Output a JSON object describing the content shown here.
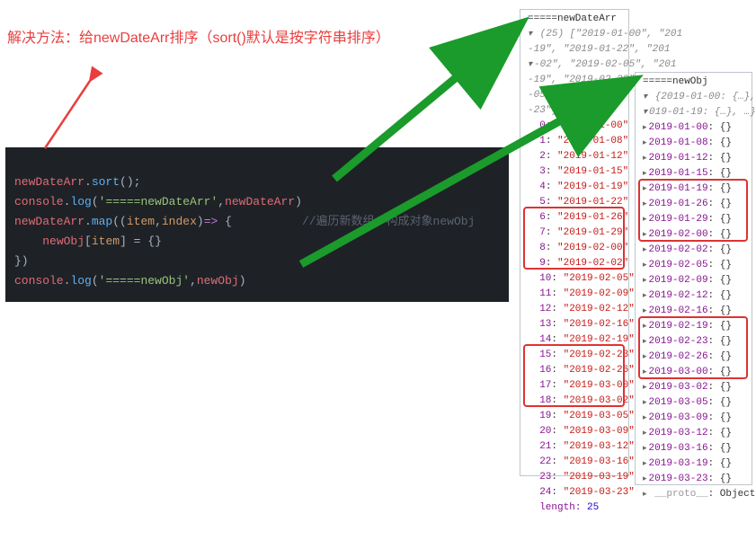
{
  "annotation": {
    "title": "解决方法：给newDateArr排序（sort()默认是按字符串排序）"
  },
  "code": {
    "l1_var": "newDateArr",
    "l1_fn": "sort",
    "l2_obj": "console",
    "l2_fn": "log",
    "l2_str": "'=====newDateArr'",
    "l2_arg": "newDateArr",
    "l3_var": "newDateArr",
    "l3_fn": "map",
    "l3_p1": "item",
    "l3_p2": "index",
    "l3_comment": "//遍历新数组，构成对象newObj",
    "l4_obj": "newObj",
    "l4_key": "item",
    "l6_obj": "console",
    "l6_fn": "log",
    "l6_str": "'=====newObj'",
    "l6_arg": "newObj"
  },
  "arr": {
    "label": "=====newDateArr",
    "summary1": "(25) [\"2019-01-00\", \"201",
    "summary2": "-19\", \"2019-01-22\", \"201",
    "summary3": "-02\", \"2019-02-05\", \"201",
    "summary4": "-19\", \"2019-02-23\", \"201",
    "summary5": "-05\", \"2019-03-",
    "summary6": "-23\"]",
    "items": [
      {
        "i": "0",
        "v": "2019-01-00"
      },
      {
        "i": "1",
        "v": "2019-01-08"
      },
      {
        "i": "2",
        "v": "2019-01-12"
      },
      {
        "i": "3",
        "v": "2019-01-15"
      },
      {
        "i": "4",
        "v": "2019-01-19"
      },
      {
        "i": "5",
        "v": "2019-01-22"
      },
      {
        "i": "6",
        "v": "2019-01-26"
      },
      {
        "i": "7",
        "v": "2019-01-29"
      },
      {
        "i": "8",
        "v": "2019-02-00"
      },
      {
        "i": "9",
        "v": "2019-02-02"
      },
      {
        "i": "10",
        "v": "2019-02-05"
      },
      {
        "i": "11",
        "v": "2019-02-09"
      },
      {
        "i": "12",
        "v": "2019-02-12"
      },
      {
        "i": "13",
        "v": "2019-02-16"
      },
      {
        "i": "14",
        "v": "2019-02-19"
      },
      {
        "i": "15",
        "v": "2019-02-23"
      },
      {
        "i": "16",
        "v": "2019-02-26"
      },
      {
        "i": "17",
        "v": "2019-03-00"
      },
      {
        "i": "18",
        "v": "2019-03-02"
      },
      {
        "i": "19",
        "v": "2019-03-05"
      },
      {
        "i": "20",
        "v": "2019-03-09"
      },
      {
        "i": "21",
        "v": "2019-03-12"
      },
      {
        "i": "22",
        "v": "2019-03-16"
      },
      {
        "i": "23",
        "v": "2019-03-19"
      },
      {
        "i": "24",
        "v": "2019-03-23"
      }
    ],
    "length_label": "length",
    "length_value": "25"
  },
  "obj": {
    "label": "=====newObj",
    "summary1": "{2019-01-00: {…}, 201",
    "summary2": "019-01-19: {…}, …}",
    "items": [
      "2019-01-00",
      "2019-01-08",
      "2019-01-12",
      "2019-01-15",
      "2019-01-19",
      "2019-01-26",
      "2019-01-29",
      "2019-02-00",
      "2019-02-02",
      "2019-02-05",
      "2019-02-09",
      "2019-02-12",
      "2019-02-16",
      "2019-02-19",
      "2019-02-23",
      "2019-02-26",
      "2019-03-00",
      "2019-03-02",
      "2019-03-05",
      "2019-03-09",
      "2019-03-12",
      "2019-03-16",
      "2019-03-19",
      "2019-03-23"
    ],
    "proto_label": "__proto__",
    "proto_value": "Object"
  }
}
